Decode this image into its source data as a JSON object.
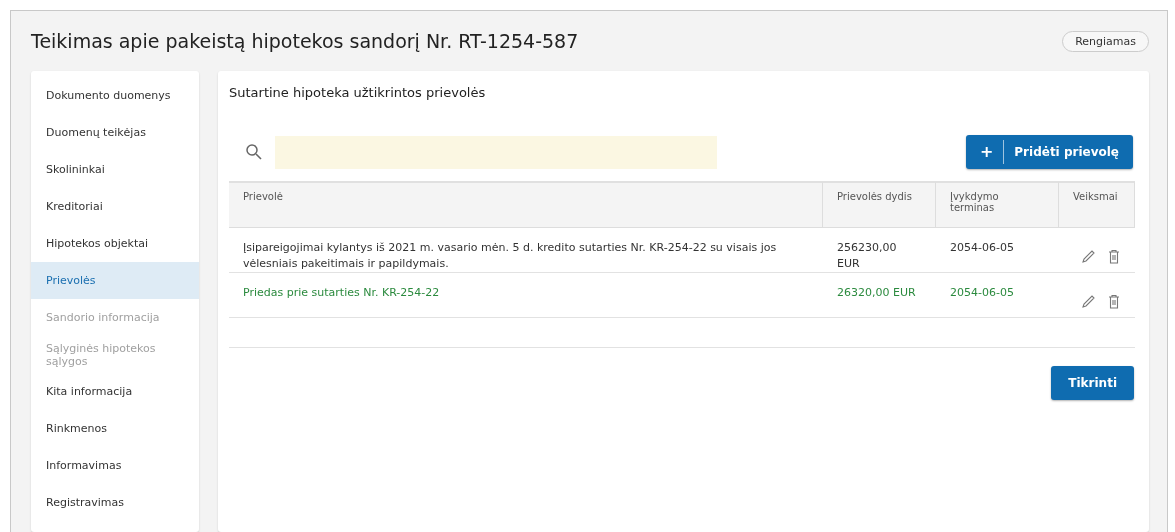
{
  "title": "Teikimas apie pakeistą hipotekos sandorį Nr. RT-1254-587",
  "status_badge": "Rengiamas",
  "sidebar": {
    "items": [
      {
        "label": "Dokumento duomenys",
        "selected": false,
        "disabled": false
      },
      {
        "label": "Duomenų teikėjas",
        "selected": false,
        "disabled": false
      },
      {
        "label": "Skolininkai",
        "selected": false,
        "disabled": false
      },
      {
        "label": "Kreditoriai",
        "selected": false,
        "disabled": false
      },
      {
        "label": "Hipotekos objektai",
        "selected": false,
        "disabled": false
      },
      {
        "label": "Prievolės",
        "selected": true,
        "disabled": false
      },
      {
        "label": "Sandorio informacija",
        "selected": false,
        "disabled": true
      },
      {
        "label": "Sąlyginės hipotekos sąlygos",
        "selected": false,
        "disabled": true
      },
      {
        "label": "Kita informacija",
        "selected": false,
        "disabled": false
      },
      {
        "label": "Rinkmenos",
        "selected": false,
        "disabled": false
      },
      {
        "label": "Informavimas",
        "selected": false,
        "disabled": false
      },
      {
        "label": "Registravimas",
        "selected": false,
        "disabled": false
      }
    ]
  },
  "section_title": "Sutartine hipoteka užtikrintos prievolės",
  "add_button": {
    "icon": "+",
    "label": "Pridėti prievolę"
  },
  "table": {
    "columns": [
      "Prievolė",
      "Prievolės dydis",
      "Įvykdymo terminas",
      "Veiksmai"
    ],
    "rows": [
      {
        "kind": "existing",
        "obligation": "Įsipareigojimai kylantys iš 2021 m. vasario mėn. 5 d. kredito sutarties Nr. KR-254-22 su visais jos vėlesniais pakeitimais ir papildymais.",
        "amount": "256230,00 EUR",
        "due": "2054-06-05"
      },
      {
        "kind": "added",
        "obligation": "Priedas prie sutarties Nr. KR-254-22",
        "amount": "26320,00  EUR",
        "due": "2054-06-05"
      }
    ]
  },
  "check_button": "Tikrinti"
}
